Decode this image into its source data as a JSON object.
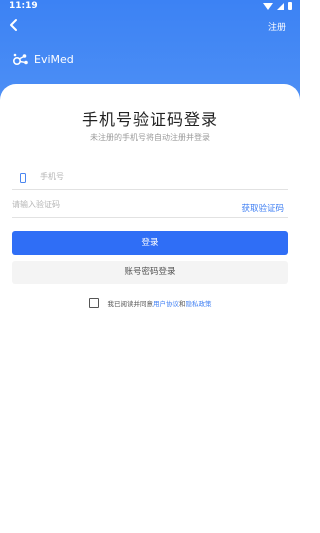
{
  "status_bar": {
    "time": "11:19"
  },
  "header": {
    "register_label": "注册"
  },
  "brand": {
    "name": "EviMed"
  },
  "main": {
    "title": "手机号验证码登录",
    "subtitle": "未注册的手机号将自动注册并登录",
    "phone_placeholder": "手机号",
    "code_placeholder": "请输入验证码",
    "get_code_label": "获取验证码",
    "login_label": "登录",
    "password_login_label": "账号密码登录"
  },
  "agreement": {
    "prefix": "我已阅读并同意",
    "user_agreement": "用户协议",
    "conjunction": "和",
    "privacy_policy": "隐私政策"
  },
  "colors": {
    "primary": "#2f6ef6",
    "header_blue": "#3c82f4",
    "link": "#3f7ff3"
  }
}
